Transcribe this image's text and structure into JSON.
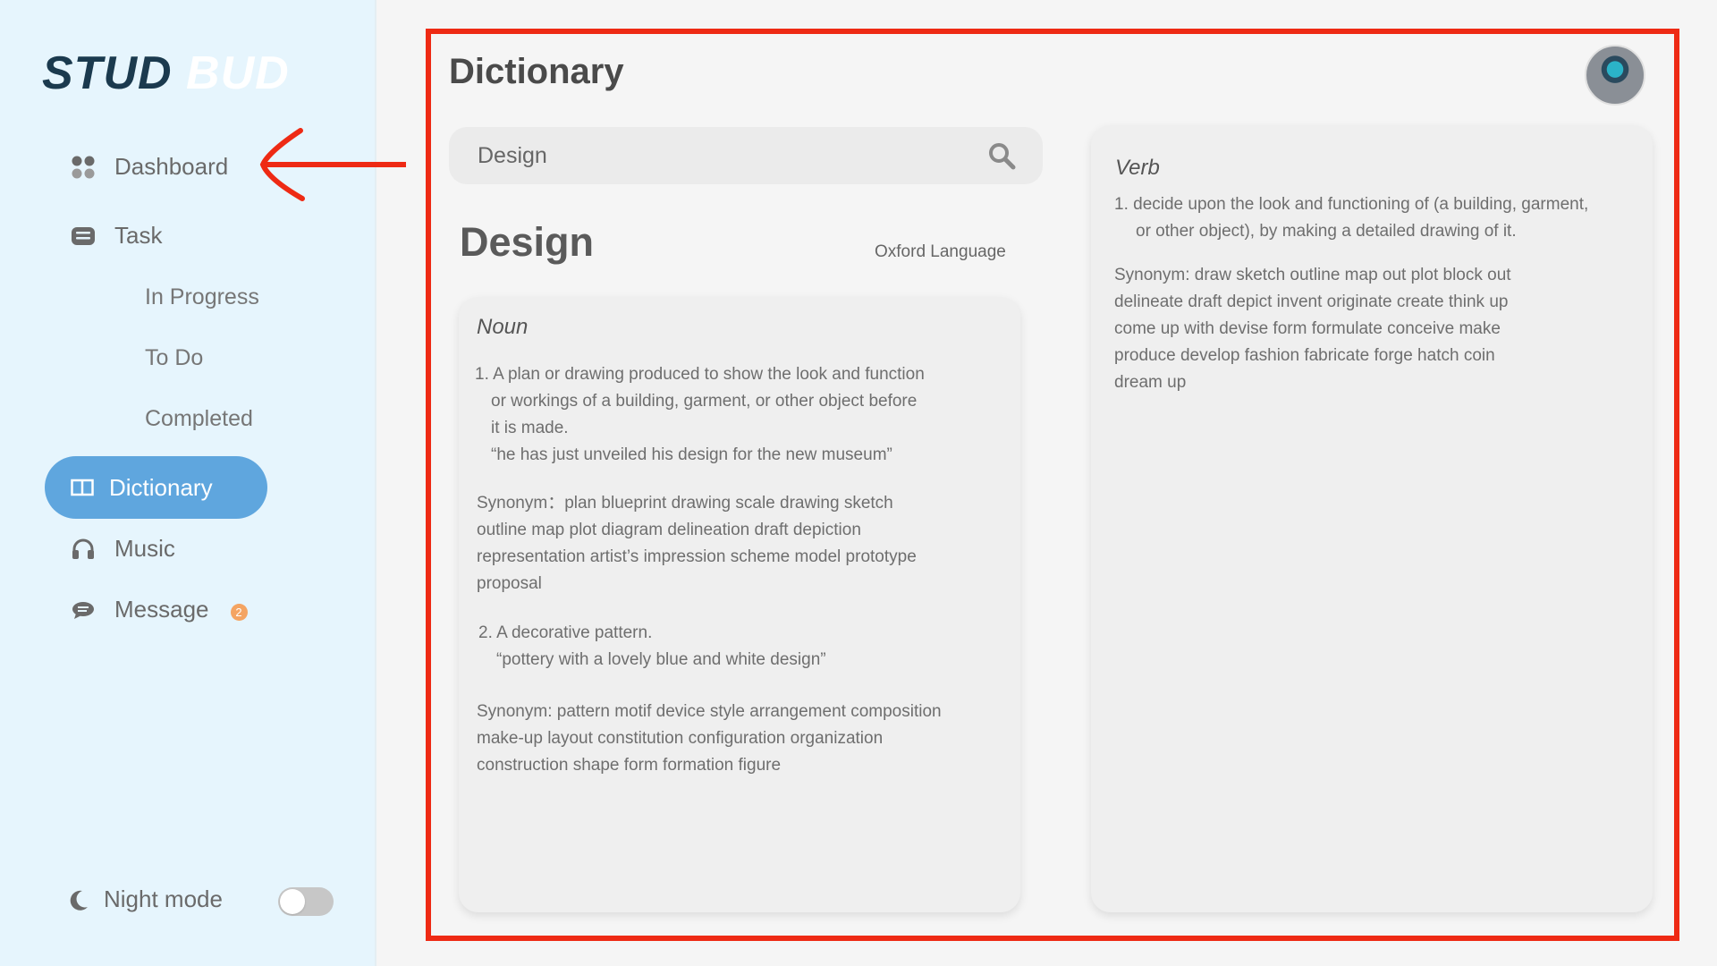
{
  "app": {
    "logo_part1": "STUD",
    "logo_part2": "BUD"
  },
  "sidebar": {
    "items": [
      {
        "label": "Dashboard",
        "icon": "grid-icon"
      },
      {
        "label": "Task",
        "icon": "list-icon"
      },
      {
        "label": "In Progress"
      },
      {
        "label": "To Do"
      },
      {
        "label": "Completed"
      },
      {
        "label": "Dictionary",
        "icon": "book-icon",
        "active": true
      },
      {
        "label": "Music",
        "icon": "headphones-icon"
      },
      {
        "label": "Message",
        "icon": "chat-icon",
        "badge": "2"
      }
    ],
    "night_mode_label": "Night mode",
    "night_mode_on": false
  },
  "main": {
    "title": "Dictionary",
    "search": {
      "value": "Design",
      "placeholder": ""
    },
    "word": "Design",
    "source": "Oxford Language",
    "noun": {
      "label": "Noun",
      "def1_line1": "1. A plan or drawing produced to show the look and function",
      "def1_line2": "or workings of a building, garment, or other object before",
      "def1_line3": "it is made.",
      "def1_example": "“he has just unveiled his design for the new museum”",
      "syn1_line1": "Synonym：plan  blueprint  drawing  scale drawing  sketch",
      "syn1_line2": "outline  map  plot  diagram  delineation  draft  depiction",
      "syn1_line3": "representation  artist’s impression  scheme  model  prototype",
      "syn1_line4": "proposal",
      "def2": "2. A decorative pattern.",
      "def2_example": "“pottery with a lovely blue and white design”",
      "syn2_line1": "Synonym: pattern  motif  device  style  arrangement  composition",
      "syn2_line2": "make-up  layout  constitution  configuration  organization",
      "syn2_line3": "construction  shape  form  formation  figure"
    },
    "verb": {
      "label": "Verb",
      "def1_line1": "1. decide upon the look and functioning of (a building, garment,",
      "def1_line2": "or other object), by making a detailed drawing of it.",
      "syn_line1": "Synonym: draw  sketch  outline  map out  plot  block out",
      "syn_line2": "delineate  draft  depict  invent  originate  create  think up",
      "syn_line3": "come up with  devise  form  formulate  conceive  make",
      "syn_line4": "produce  develop  fashion  fabricate  forge  hatch  coin",
      "syn_line5": "dream up"
    }
  },
  "colors": {
    "sidebar_bg": "#e6f5fd",
    "accent": "#5fa6de",
    "logo_dark": "#1b3a4e",
    "annotation_red": "#ee2a14",
    "badge": "#f4a462"
  }
}
